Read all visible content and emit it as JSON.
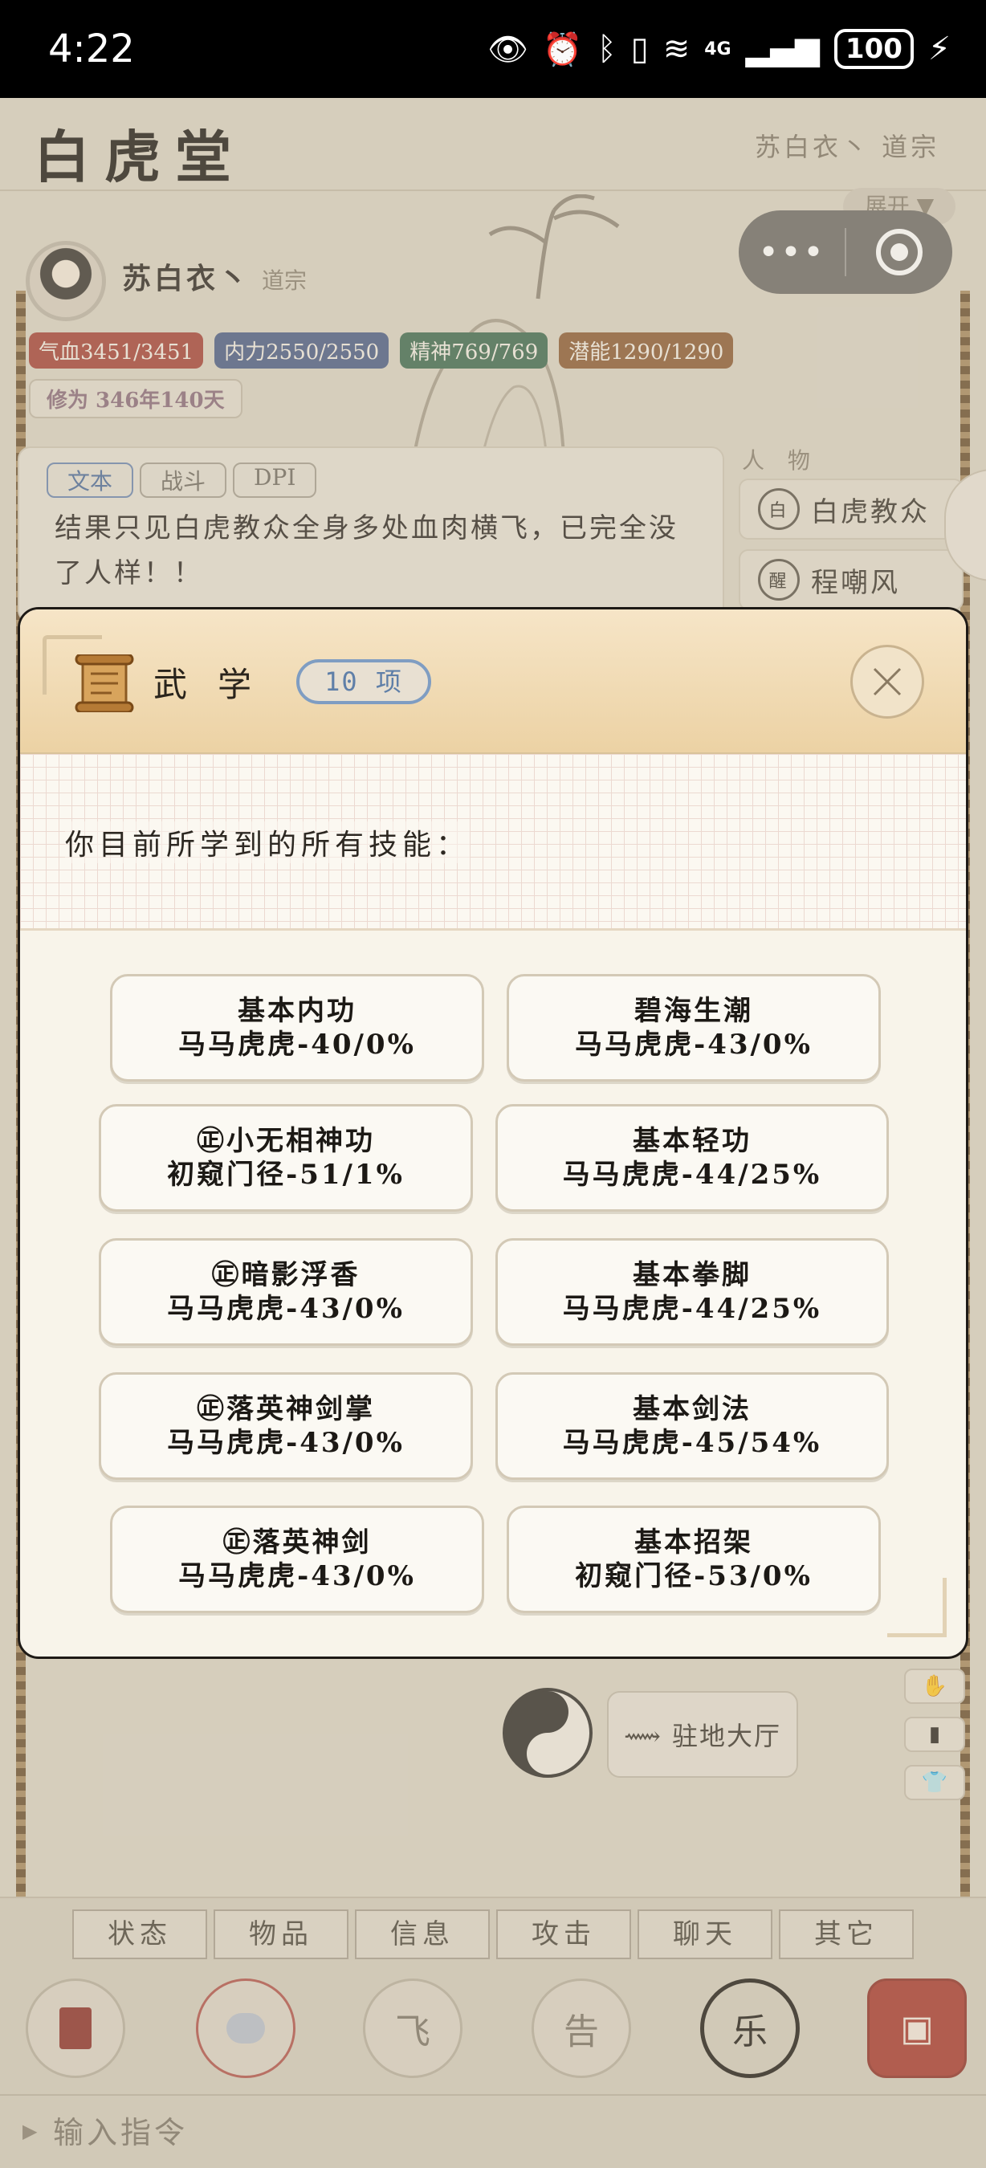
{
  "status_bar": {
    "time": "4:22",
    "battery": "100",
    "network": "4G"
  },
  "app": {
    "logo": "白虎堂",
    "header_user": "苏白衣丶  道宗",
    "expand_label": "展开 ▼"
  },
  "player": {
    "name": "苏白衣丶",
    "sect": "道宗",
    "hp": "气血3451/3451",
    "mp": "内力2550/2550",
    "spirit": "精神769/769",
    "potential": "潜能1290/1290",
    "cultivation": "修为  346年140天"
  },
  "log": {
    "tabs": [
      "文本",
      "战斗",
      "DPI"
    ],
    "text": "结果只见白虎教众全身多处血肉横飞，已完全没了人样！！"
  },
  "people": {
    "title": "人 物",
    "items": [
      {
        "badge": "白",
        "name": "白虎教众"
      },
      {
        "badge": "醒",
        "name": "程嘲风"
      }
    ]
  },
  "modal": {
    "title": "武学",
    "count": "10 项",
    "subtitle": "你目前所学到的所有技能：",
    "skills": [
      {
        "name": "基本内功",
        "detail": "马马虎虎-40/0%"
      },
      {
        "name": "碧海生潮",
        "detail": "马马虎虎-43/0%"
      },
      {
        "name": "㊣小无相神功",
        "detail": "初窥门径-51/1%"
      },
      {
        "name": "基本轻功",
        "detail": "马马虎虎-44/25%"
      },
      {
        "name": "㊣暗影浮香",
        "detail": "马马虎虎-43/0%"
      },
      {
        "name": "基本拳脚",
        "detail": "马马虎虎-44/25%"
      },
      {
        "name": "㊣落英神剑掌",
        "detail": "马马虎虎-43/0%"
      },
      {
        "name": "基本剑法",
        "detail": "马马虎虎-45/54%"
      },
      {
        "name": "㊣落英神剑",
        "detail": "马马虎虎-43/0%"
      },
      {
        "name": "基本招架",
        "detail": "初窥门径-53/0%"
      }
    ]
  },
  "hall_button": "⟿ 驻地大厅",
  "nav": [
    "状态",
    "物品",
    "信息",
    "攻击",
    "聊天",
    "其它"
  ],
  "actions": [
    {
      "icon": "book-icon",
      "label": ""
    },
    {
      "icon": "chat-icon",
      "label": ""
    },
    {
      "icon": "fly-icon",
      "label": "飞"
    },
    {
      "icon": "notice-icon",
      "label": "告"
    },
    {
      "icon": "music-icon",
      "label": "乐"
    },
    {
      "icon": "draw-icon",
      "label": ""
    }
  ],
  "command": {
    "placeholder": "输入指令"
  },
  "colors": {
    "modal_header": "#ecd2a4",
    "count_pill_border": "#7f9dc2",
    "hp": "#a64236",
    "mp": "#4a5c86",
    "spirit": "#3d6a4f",
    "potential": "#8c5a33"
  }
}
